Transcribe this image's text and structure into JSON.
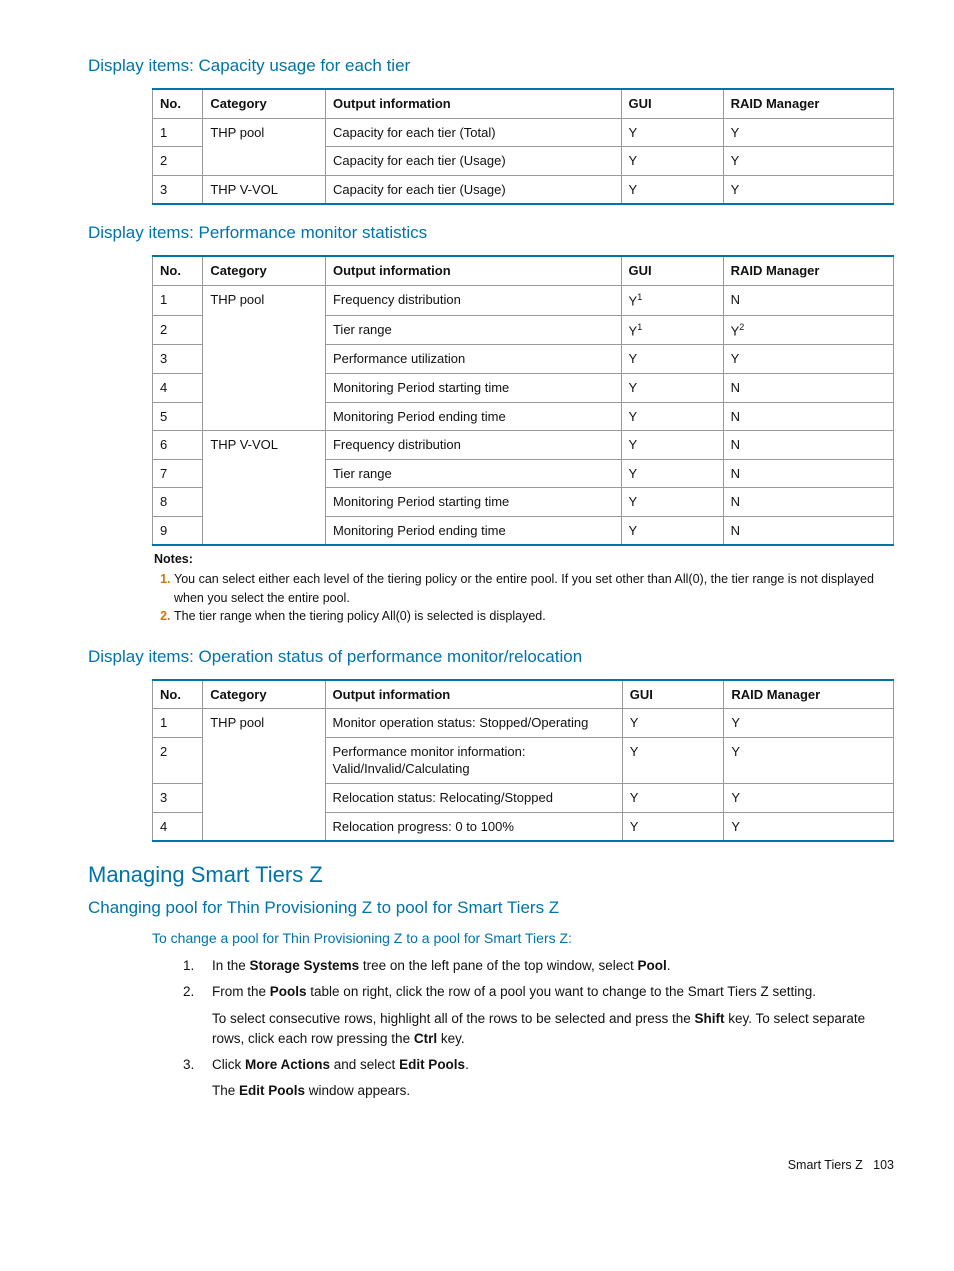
{
  "headings": {
    "h1_capacity": "Display items: Capacity usage for each tier",
    "h1_perfstats": "Display items: Performance monitor statistics",
    "h1_opstatus": "Display items: Operation status of performance monitor/relocation",
    "h1_managing": "Managing Smart Tiers Z",
    "h2_changing": "Changing pool for Thin Provisioning Z to pool for Smart Tiers Z",
    "intro_change": "To change a pool for Thin Provisioning Z to a pool for Smart Tiers Z:"
  },
  "columns": {
    "no": "No.",
    "category": "Category",
    "output": "Output information",
    "gui": "GUI",
    "raid": "RAID Manager"
  },
  "table_capacity": [
    {
      "no": "1",
      "cat": "THP pool",
      "out": "Capacity for each tier (Total)",
      "gui": "Y",
      "raid": "Y",
      "catspan": "start"
    },
    {
      "no": "2",
      "cat": "",
      "out": "Capacity for each tier (Usage)",
      "gui": "Y",
      "raid": "Y",
      "catspan": "end"
    },
    {
      "no": "3",
      "cat": "THP V-VOL",
      "out": "Capacity for each tier (Usage)",
      "gui": "Y",
      "raid": "Y"
    }
  ],
  "table_perf": [
    {
      "no": "1",
      "cat": "THP pool",
      "out": "Frequency distribution",
      "gui": "Y",
      "gui_sup": "1",
      "raid": "N",
      "catspan": "start"
    },
    {
      "no": "2",
      "cat": "",
      "out": "Tier range",
      "gui": "Y",
      "gui_sup": "1",
      "raid": "Y",
      "raid_sup": "2",
      "catspan": "mid"
    },
    {
      "no": "3",
      "cat": "",
      "out": "Performance utilization",
      "gui": "Y",
      "raid": "Y",
      "catspan": "mid"
    },
    {
      "no": "4",
      "cat": "",
      "out": "Monitoring Period starting time",
      "gui": "Y",
      "raid": "N",
      "catspan": "mid"
    },
    {
      "no": "5",
      "cat": "",
      "out": "Monitoring Period ending time",
      "gui": "Y",
      "raid": "N",
      "catspan": "end"
    },
    {
      "no": "6",
      "cat": "THP V-VOL",
      "out": "Frequency distribution",
      "gui": "Y",
      "raid": "N",
      "catspan": "start"
    },
    {
      "no": "7",
      "cat": "",
      "out": "Tier range",
      "gui": "Y",
      "raid": "N",
      "catspan": "mid"
    },
    {
      "no": "8",
      "cat": "",
      "out": "Monitoring Period starting time",
      "gui": "Y",
      "raid": "N",
      "catspan": "mid"
    },
    {
      "no": "9",
      "cat": "",
      "out": "Monitoring Period ending time",
      "gui": "Y",
      "raid": "N",
      "catspan": "end"
    }
  ],
  "notes": {
    "label": "Notes:",
    "items": [
      "You can select either each level of the tiering policy or the entire pool. If you set other than All(0), the tier range is not displayed when you select the entire pool.",
      "The tier range when the tiering policy All(0) is selected is displayed."
    ]
  },
  "table_op": [
    {
      "no": "1",
      "cat": "THP pool",
      "out": "Monitor operation status: Stopped/Operating",
      "gui": "Y",
      "raid": "Y",
      "catspan": "start"
    },
    {
      "no": "2",
      "cat": "",
      "out": "Performance monitor information: Valid/Invalid/Calculating",
      "gui": "Y",
      "raid": "Y",
      "catspan": "mid"
    },
    {
      "no": "3",
      "cat": "",
      "out": "Relocation status: Relocating/Stopped",
      "gui": "Y",
      "raid": "Y",
      "catspan": "mid"
    },
    {
      "no": "4",
      "cat": "",
      "out": "Relocation progress: 0 to 100%",
      "gui": "Y",
      "raid": "Y",
      "catspan": "end"
    }
  ],
  "steps": {
    "s1a": "In the ",
    "s1b": "Storage Systems",
    "s1c": " tree on the left pane of the top window, select ",
    "s1d": "Pool",
    "s1e": ".",
    "s2a": "From the ",
    "s2b": "Pools",
    "s2c": " table on right, click the row of a pool you want to change to the Smart Tiers Z setting.",
    "s2p2a": "To select consecutive rows, highlight all of the rows to be selected and press the ",
    "s2p2b": "Shift",
    "s2p2c": " key. To select separate rows, click each row pressing the ",
    "s2p2d": "Ctrl",
    "s2p2e": " key.",
    "s3a": "Click ",
    "s3b": "More Actions",
    "s3c": " and select ",
    "s3d": "Edit Pools",
    "s3e": ".",
    "s3p2a": "The ",
    "s3p2b": "Edit Pools",
    "s3p2c": " window appears."
  },
  "footer": {
    "label": "Smart Tiers Z",
    "pageno": "103"
  }
}
